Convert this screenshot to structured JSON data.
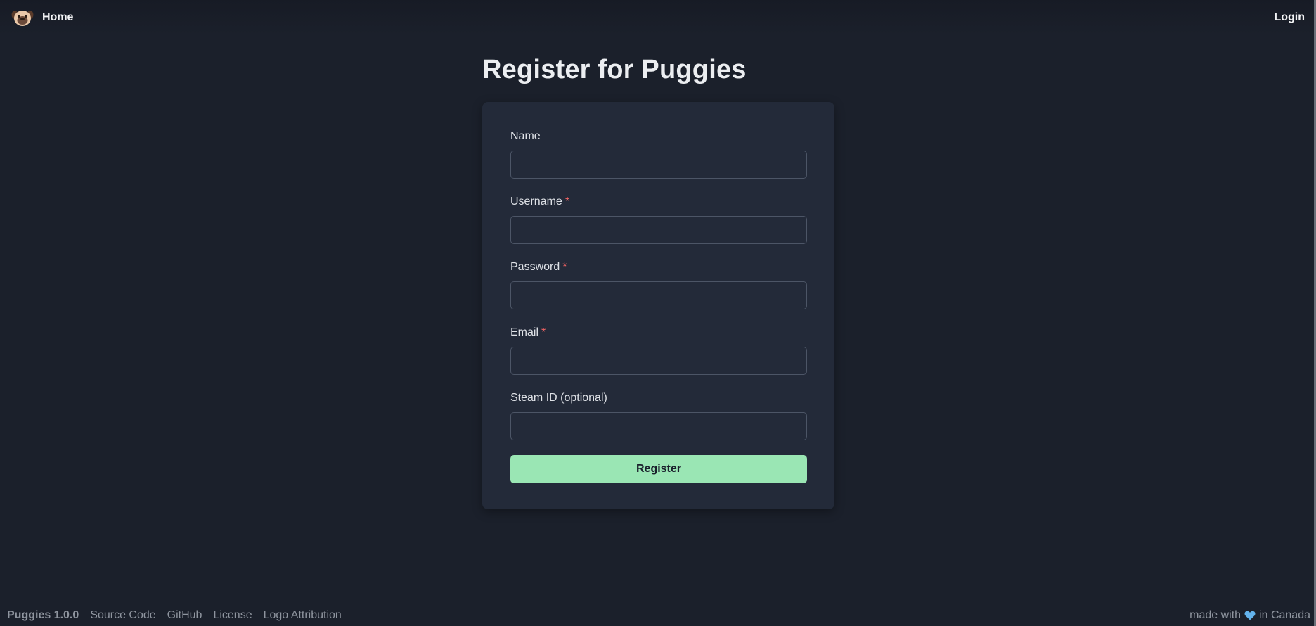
{
  "nav": {
    "logo_icon": "pug-face-icon",
    "home_label": "Home",
    "login_label": "Login"
  },
  "page": {
    "title": "Register for Puggies"
  },
  "form": {
    "name_label": "Name",
    "name_value": "",
    "username_label": "Username",
    "username_value": "",
    "password_label": "Password",
    "password_value": "",
    "email_label": "Email",
    "email_value": "",
    "steam_label": "Steam ID (optional)",
    "steam_value": "",
    "required_marker": "*",
    "submit_label": "Register"
  },
  "footer": {
    "version": "Puggies 1.0.0",
    "links": [
      "Source Code",
      "GitHub",
      "License",
      "Logo Attribution"
    ],
    "made_with_prefix": "made with",
    "made_with_suffix": "in Canada",
    "heart_icon": "heart-icon"
  },
  "colors": {
    "background": "#1b202b",
    "card": "#232a39",
    "accent_button": "#9ae6b4",
    "required": "#f56565",
    "heart": "#63b3ed"
  }
}
